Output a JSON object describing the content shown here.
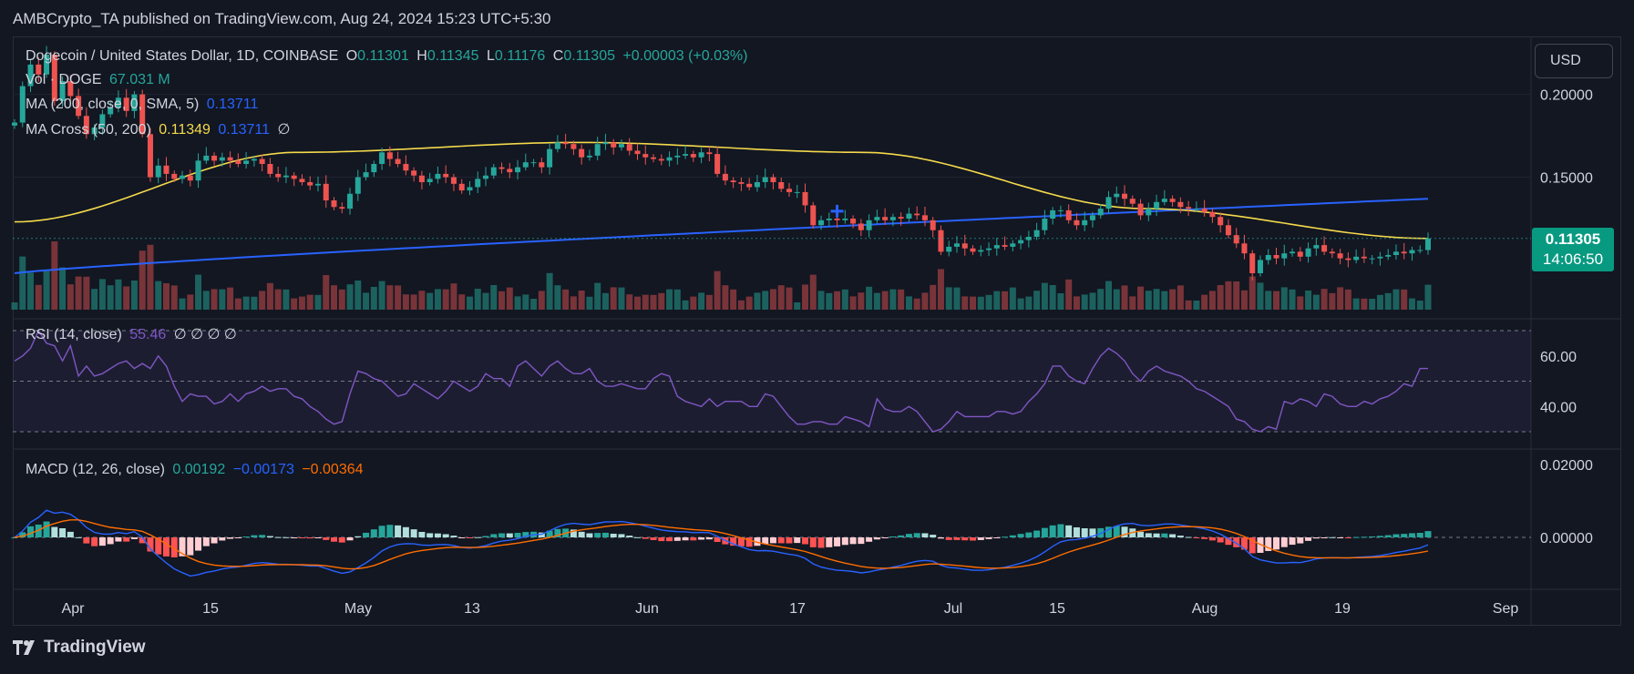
{
  "header": {
    "published": "AMBCrypto_TA published on TradingView.com, Aug 24, 2024 15:23 UTC+5:30"
  },
  "footer": {
    "brand": "TradingView"
  },
  "currency_button": "USD",
  "symbol_line": {
    "name": "Dogecoin / United States Dollar, 1D, COINBASE",
    "o_label": "O",
    "o": "0.11301",
    "h_label": "H",
    "h": "0.11345",
    "l_label": "L",
    "l": "0.11176",
    "c_label": "C",
    "c": "0.11305",
    "change": "+0.00003 (+0.03%)"
  },
  "vol_line": {
    "label": "Vol · DOGE",
    "value": "67.031 M"
  },
  "ma_line": {
    "label": "MA (200, close, 0, SMA, 5)",
    "value": "0.13711"
  },
  "ma_cross_line": {
    "label": "MA Cross (50, 200)",
    "v1": "0.11349",
    "v2": "0.13711",
    "extra": "∅"
  },
  "rsi_line": {
    "label": "RSI (14, close)",
    "value": "55.46",
    "extra": "∅ ∅ ∅ ∅"
  },
  "macd_line": {
    "label": "MACD (12, 26, close)",
    "v1": "0.00192",
    "v2": "−0.00173",
    "v3": "−0.00364"
  },
  "price_badge": {
    "price": "0.11305",
    "countdown": "14:06:50"
  },
  "colors": {
    "up": "#26a69a",
    "down": "#ef5350",
    "ma200": "#2962ff",
    "ma50": "#f5d94b",
    "rsi": "#7e57c2",
    "macd": "#2962ff",
    "signal": "#ff6d00"
  },
  "chart_data": [
    {
      "type": "candlestick",
      "title": "Dogecoin / United States Dollar, 1D, COINBASE",
      "x_ticks": [
        "Apr",
        "15",
        "May",
        "13",
        "Jun",
        "17",
        "Jul",
        "15",
        "Aug",
        "19",
        "Sep"
      ],
      "y_ticks": [
        "0.20000",
        "0.15000"
      ],
      "ylim": [
        0.07,
        0.235
      ],
      "close": [
        0.183,
        0.205,
        0.218,
        0.212,
        0.224,
        0.196,
        0.208,
        0.199,
        0.187,
        0.176,
        0.18,
        0.188,
        0.192,
        0.198,
        0.19,
        0.2,
        0.176,
        0.15,
        0.157,
        0.152,
        0.149,
        0.151,
        0.148,
        0.16,
        0.163,
        0.16,
        0.162,
        0.16,
        0.158,
        0.16,
        0.161,
        0.158,
        0.152,
        0.15,
        0.151,
        0.149,
        0.147,
        0.145,
        0.146,
        0.136,
        0.132,
        0.131,
        0.14,
        0.15,
        0.153,
        0.158,
        0.165,
        0.161,
        0.158,
        0.154,
        0.151,
        0.147,
        0.149,
        0.152,
        0.15,
        0.146,
        0.142,
        0.144,
        0.149,
        0.151,
        0.156,
        0.155,
        0.153,
        0.156,
        0.159,
        0.159,
        0.156,
        0.167,
        0.171,
        0.17,
        0.167,
        0.162,
        0.163,
        0.17,
        0.171,
        0.168,
        0.17,
        0.166,
        0.164,
        0.162,
        0.161,
        0.16,
        0.162,
        0.163,
        0.164,
        0.162,
        0.165,
        0.164,
        0.152,
        0.148,
        0.147,
        0.146,
        0.144,
        0.147,
        0.15,
        0.147,
        0.143,
        0.141,
        0.141,
        0.133,
        0.121,
        0.124,
        0.125,
        0.124,
        0.125,
        0.122,
        0.118,
        0.124,
        0.126,
        0.124,
        0.126,
        0.125,
        0.128,
        0.127,
        0.124,
        0.118,
        0.105,
        0.108,
        0.11,
        0.107,
        0.105,
        0.106,
        0.107,
        0.109,
        0.108,
        0.11,
        0.112,
        0.114,
        0.118,
        0.125,
        0.13,
        0.13,
        0.124,
        0.121,
        0.124,
        0.127,
        0.131,
        0.138,
        0.14,
        0.137,
        0.134,
        0.127,
        0.131,
        0.135,
        0.137,
        0.135,
        0.132,
        0.131,
        0.131,
        0.129,
        0.126,
        0.121,
        0.115,
        0.11,
        0.104,
        0.092,
        0.1,
        0.103,
        0.101,
        0.104,
        0.105,
        0.102,
        0.107,
        0.109,
        0.105,
        0.104,
        0.101,
        0.1,
        0.102,
        0.101,
        0.101,
        0.102,
        0.103,
        0.105,
        0.104,
        0.106,
        0.106,
        0.113
      ],
      "ma200": [
        0.092,
        0.137
      ],
      "ma50": [
        0.123,
        0.165,
        0.171,
        0.165,
        0.131,
        0.113
      ]
    },
    {
      "type": "bar",
      "title": "Vol · DOGE",
      "series": [
        {
          "name": "Vol · DOGE",
          "last_value": "67.031 M"
        }
      ]
    },
    {
      "type": "line",
      "title": "RSI (14, close)",
      "y_ticks": [
        "60.00",
        "40.00"
      ],
      "ylim": [
        20,
        80
      ],
      "bands": [
        70,
        50,
        30
      ],
      "values": [
        58,
        60,
        63,
        70,
        65,
        64,
        58,
        64,
        52,
        56,
        52,
        53,
        55,
        57,
        58,
        55,
        57,
        55,
        60,
        56,
        48,
        42,
        45,
        44,
        44,
        41,
        42,
        45,
        42,
        45,
        46,
        48,
        46,
        47,
        47,
        44,
        43,
        40,
        38,
        35,
        33,
        34,
        45,
        54,
        53,
        51,
        50,
        47,
        44,
        45,
        49,
        47,
        45,
        43,
        46,
        50,
        48,
        46,
        48,
        53,
        51,
        51,
        48,
        56,
        58,
        55,
        52,
        56,
        58,
        55,
        53,
        53,
        55,
        50,
        48,
        48,
        49,
        48,
        47,
        47,
        51,
        53,
        52,
        44,
        42,
        41,
        40,
        43,
        40,
        42,
        42,
        42,
        40,
        40,
        45,
        44,
        40,
        36,
        33,
        33,
        34,
        34,
        33,
        33,
        36,
        35,
        34,
        32,
        43,
        39,
        38,
        38,
        40,
        38,
        34,
        30,
        31,
        34,
        38,
        36,
        36,
        36,
        36,
        38,
        38,
        37,
        38,
        42,
        45,
        49,
        56,
        56,
        52,
        50,
        49,
        55,
        60,
        63,
        61,
        58,
        53,
        50,
        54,
        56,
        54,
        53,
        52,
        50,
        47,
        46,
        44,
        42,
        40,
        35,
        34,
        31,
        30,
        32,
        31,
        42,
        41,
        43,
        42,
        40,
        45,
        44,
        41,
        40,
        40,
        42,
        41,
        43,
        44,
        46,
        49,
        48,
        55,
        55
      ]
    },
    {
      "type": "line",
      "title": "MACD (12, 26, close)",
      "y_ticks": [
        "0.02000",
        "0.00000"
      ],
      "ylim": [
        -0.012,
        0.024
      ],
      "series": [
        {
          "name": "MACD",
          "last_value": "0.00192"
        },
        {
          "name": "Signal",
          "last_value": "−0.00173"
        },
        {
          "name": "Histogram",
          "last_value": "−0.00364"
        }
      ]
    }
  ]
}
